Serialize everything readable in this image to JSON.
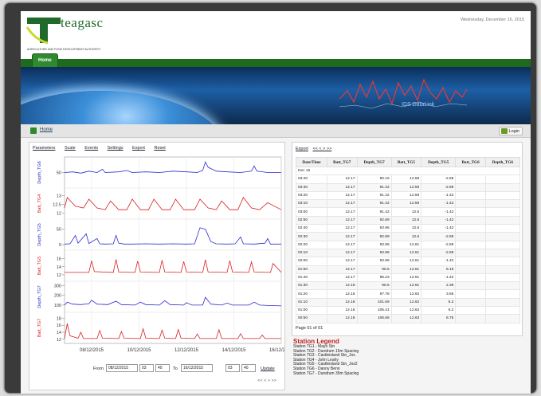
{
  "header": {
    "brand": "teagasc",
    "tagline": "AGRICULTURE AND FOOD DEVELOPMENT AUTHORITY",
    "date": "Wednesday, December 16, 2015",
    "nav_home": "Home",
    "banner_text": "IDS DataLink"
  },
  "crumb": {
    "home": "Home",
    "login": "Login"
  },
  "toolbar": [
    "Parameters",
    "Scale",
    "Events",
    "Settings",
    "Export",
    "Reset"
  ],
  "date_range": {
    "from_label": "From",
    "from_date": "08/12/2015",
    "from_hour": "03",
    "from_min": "40",
    "to_label": "To",
    "to_date": "16/12/2015",
    "to_hour": "03",
    "to_min": "40",
    "update": "Update",
    "pager": "<< < > >>"
  },
  "table_nav": {
    "export": "Export",
    "pager": "<< < > >>"
  },
  "table": {
    "columns": [
      "Date/Time",
      "Batt_TG7",
      "Depth_TG7",
      "Batt_TG5",
      "Depth_TG5",
      "Batt_TG6",
      "Depth_TG6"
    ],
    "group": "Dec 16",
    "rows": [
      [
        "03:40",
        "12.17",
        "90.15",
        "12.58",
        "-2.69",
        "",
        ""
      ],
      [
        "03:30",
        "12.17",
        "91.42",
        "12.59",
        "-2.69",
        "",
        ""
      ],
      [
        "03:20",
        "12.17",
        "91.42",
        "12.59",
        "-1.42",
        "",
        ""
      ],
      [
        "03:10",
        "12.17",
        "91.42",
        "12.59",
        "-1.42",
        "",
        ""
      ],
      [
        "03:00",
        "12.17",
        "91.42",
        "12.6",
        "-1.42",
        "",
        ""
      ],
      [
        "02:50",
        "12.17",
        "92.69",
        "12.6",
        "-1.42",
        "",
        ""
      ],
      [
        "02:40",
        "12.17",
        "93.96",
        "12.6",
        "-1.42",
        "",
        ""
      ],
      [
        "02:30",
        "12.17",
        "92.69",
        "12.6",
        "-2.69",
        "",
        ""
      ],
      [
        "02:20",
        "12.17",
        "93.96",
        "12.61",
        "-2.69",
        "",
        ""
      ],
      [
        "02:10",
        "12.17",
        "93.96",
        "12.61",
        "-2.69",
        "",
        ""
      ],
      [
        "02:00",
        "12.17",
        "93.96",
        "12.61",
        "-1.42",
        "",
        ""
      ],
      [
        "01:50",
        "12.17",
        "96.5",
        "12.61",
        "8.15",
        "",
        ""
      ],
      [
        "01:40",
        "12.17",
        "95.23",
        "12.61",
        "-1.42",
        "",
        ""
      ],
      [
        "01:30",
        "12.18",
        "96.5",
        "12.61",
        "2.39",
        "",
        ""
      ],
      [
        "01:20",
        "12.18",
        "97.78",
        "12.62",
        "3.66",
        "",
        ""
      ],
      [
        "01:10",
        "12.18",
        "101.59",
        "12.62",
        "6.2",
        "",
        ""
      ],
      [
        "01:00",
        "12.18",
        "105.41",
        "12.62",
        "6.2",
        "",
        ""
      ],
      [
        "00:50",
        "12.18",
        "106.68",
        "12.63",
        "8.75",
        "",
        ""
      ]
    ],
    "page_info": "Page 01 of 01"
  },
  "legend": {
    "title": "Station Legend",
    "items": [
      "Station TG1 - Mayo Stn",
      "Station TG2 - Dundrum 15m Spacing",
      "Station TG3 - Castleisland Stn_Jos",
      "Station TG4 - John Leahy",
      "Station TG5 - Castleisland Stn_Jos2",
      "Station TG6 - Danny Benn",
      "Station TG7 - Dundrum 35m Spacing"
    ]
  },
  "colors": {
    "depth": "#2b2bd0",
    "batt": "#d82020",
    "brand": "#1f6a2a",
    "nav": "#1e6b1e"
  },
  "chart_data": {
    "type": "line",
    "x_ticks": [
      "08/12/2015",
      "10/12/2015",
      "12/12/2015",
      "14/12/2015",
      "16/12/2015"
    ],
    "xlim": [
      0,
      8
    ],
    "panels": [
      {
        "series": "Depth_TG6",
        "ylabel": "Depth_TG6",
        "color": "#2b2bd0",
        "ticks": [
          50
        ],
        "ylim": [
          30,
          70
        ],
        "points": [
          [
            0,
            50
          ],
          [
            0.3,
            51
          ],
          [
            0.6,
            49
          ],
          [
            0.9,
            52
          ],
          [
            1.2,
            50
          ],
          [
            1.4,
            55
          ],
          [
            1.5,
            50
          ],
          [
            2,
            51
          ],
          [
            2.3,
            53
          ],
          [
            2.5,
            50
          ],
          [
            3,
            51
          ],
          [
            3.5,
            50
          ],
          [
            4,
            52
          ],
          [
            4.5,
            51
          ],
          [
            4.9,
            50
          ],
          [
            5.1,
            53
          ],
          [
            5.2,
            66
          ],
          [
            5.3,
            58
          ],
          [
            5.6,
            52
          ],
          [
            6,
            51
          ],
          [
            6.5,
            50
          ],
          [
            6.9,
            52
          ],
          [
            7,
            60
          ],
          [
            7.1,
            52
          ],
          [
            7.5,
            50
          ],
          [
            8,
            50
          ]
        ]
      },
      {
        "series": "Batt_TG4",
        "ylabel": "Batt_TG4",
        "color": "#d82020",
        "ticks": [
          12,
          12.5,
          13
        ],
        "ylim": [
          11.8,
          13.3
        ],
        "points": [
          [
            0,
            12.3
          ],
          [
            0.1,
            12.9
          ],
          [
            0.4,
            12.4
          ],
          [
            0.7,
            12.3
          ],
          [
            0.9,
            12.8
          ],
          [
            1.2,
            12.3
          ],
          [
            1.5,
            12.2
          ],
          [
            1.7,
            12.7
          ],
          [
            2.0,
            12.2
          ],
          [
            2.3,
            12.2
          ],
          [
            2.5,
            12.8
          ],
          [
            2.8,
            12.2
          ],
          [
            3.1,
            12.2
          ],
          [
            3.3,
            12.8
          ],
          [
            3.6,
            12.2
          ],
          [
            3.9,
            12.2
          ],
          [
            4.1,
            12.8
          ],
          [
            4.4,
            12.2
          ],
          [
            4.8,
            12.2
          ],
          [
            5.0,
            12.8
          ],
          [
            5.3,
            12.3
          ],
          [
            5.6,
            12.2
          ],
          [
            5.8,
            12.7
          ],
          [
            6.1,
            12.2
          ],
          [
            6.4,
            12.2
          ],
          [
            6.6,
            12.9
          ],
          [
            6.9,
            12.3
          ],
          [
            7.2,
            12.2
          ],
          [
            7.5,
            12.6
          ],
          [
            8,
            12.2
          ]
        ]
      },
      {
        "series": "Depth_TG5",
        "ylabel": "Depth_TG5",
        "color": "#2b2bd0",
        "ticks": [
          0,
          50
        ],
        "ylim": [
          -10,
          75
        ],
        "points": [
          [
            0,
            2
          ],
          [
            0.2,
            3
          ],
          [
            0.4,
            30
          ],
          [
            0.5,
            5
          ],
          [
            0.8,
            35
          ],
          [
            0.9,
            4
          ],
          [
            1.2,
            20
          ],
          [
            1.3,
            3
          ],
          [
            1.5,
            2
          ],
          [
            1.8,
            3
          ],
          [
            1.9,
            30
          ],
          [
            2.0,
            5
          ],
          [
            2.2,
            2
          ],
          [
            2.5,
            2
          ],
          [
            3,
            3
          ],
          [
            3.5,
            2
          ],
          [
            4,
            3
          ],
          [
            4.5,
            2
          ],
          [
            4.8,
            3
          ],
          [
            5.0,
            55
          ],
          [
            5.2,
            50
          ],
          [
            5.4,
            10
          ],
          [
            5.6,
            3
          ],
          [
            6,
            2
          ],
          [
            6.3,
            3
          ],
          [
            6.5,
            25
          ],
          [
            6.6,
            3
          ],
          [
            7,
            2
          ],
          [
            7.4,
            5
          ],
          [
            7.5,
            20
          ],
          [
            7.6,
            2
          ],
          [
            8,
            2
          ]
        ]
      },
      {
        "series": "Batt_TG5",
        "ylabel": "Batt_TG5",
        "color": "#d82020",
        "ticks": [
          12,
          14,
          16
        ],
        "ylim": [
          11,
          17.5
        ],
        "points": [
          [
            0,
            12.6
          ],
          [
            0.9,
            12.6
          ],
          [
            1.0,
            15.5
          ],
          [
            1.1,
            12.8
          ],
          [
            1.8,
            12.6
          ],
          [
            1.9,
            15.8
          ],
          [
            2.0,
            12.7
          ],
          [
            2.6,
            12.6
          ],
          [
            2.7,
            15.4
          ],
          [
            2.8,
            12.7
          ],
          [
            3.5,
            12.6
          ],
          [
            3.6,
            15.6
          ],
          [
            3.7,
            12.7
          ],
          [
            4.3,
            12.6
          ],
          [
            4.4,
            15.3
          ],
          [
            4.5,
            12.7
          ],
          [
            5.1,
            12.6
          ],
          [
            5.2,
            15.7
          ],
          [
            5.3,
            12.7
          ],
          [
            6.0,
            12.6
          ],
          [
            6.1,
            15.5
          ],
          [
            6.2,
            12.7
          ],
          [
            6.8,
            12.6
          ],
          [
            6.9,
            15.2
          ],
          [
            7.0,
            12.7
          ],
          [
            7.6,
            12.6
          ],
          [
            7.7,
            14.8
          ],
          [
            8,
            12.6
          ]
        ]
      },
      {
        "series": "Depth_TG7",
        "ylabel": "Depth_TG7",
        "color": "#2b2bd0",
        "ticks": [
          100,
          200,
          300
        ],
        "ylim": [
          50,
          320
        ],
        "points": [
          [
            0,
            100
          ],
          [
            0.1,
            130
          ],
          [
            0.3,
            110
          ],
          [
            0.6,
            105
          ],
          [
            0.9,
            115
          ],
          [
            1.0,
            150
          ],
          [
            1.2,
            110
          ],
          [
            1.6,
            105
          ],
          [
            1.9,
            140
          ],
          [
            2.1,
            105
          ],
          [
            2.6,
            100
          ],
          [
            2.8,
            130
          ],
          [
            3.0,
            105
          ],
          [
            3.5,
            100
          ],
          [
            3.7,
            145
          ],
          [
            3.9,
            105
          ],
          [
            4.4,
            100
          ],
          [
            4.5,
            125
          ],
          [
            4.7,
            100
          ],
          [
            5.1,
            100
          ],
          [
            5.2,
            180
          ],
          [
            5.4,
            110
          ],
          [
            5.8,
            100
          ],
          [
            6.0,
            120
          ],
          [
            6.2,
            100
          ],
          [
            6.8,
            100
          ],
          [
            7.0,
            130
          ],
          [
            7.2,
            100
          ],
          [
            7.6,
            95
          ],
          [
            8,
            92
          ]
        ]
      },
      {
        "series": "Batt_TG7",
        "ylabel": "Batt_TG7",
        "color": "#d82020",
        "ticks": [
          12,
          14,
          16,
          18
        ],
        "ylim": [
          11.5,
          19
        ],
        "points": [
          [
            0,
            12.2
          ],
          [
            0.1,
            16.5
          ],
          [
            0.2,
            13
          ],
          [
            0.5,
            12.3
          ],
          [
            0.6,
            14
          ],
          [
            0.7,
            12.2
          ],
          [
            1.2,
            12.2
          ],
          [
            1.3,
            14.5
          ],
          [
            1.4,
            12.3
          ],
          [
            2.0,
            12.2
          ],
          [
            2.1,
            14.2
          ],
          [
            2.2,
            12.3
          ],
          [
            2.8,
            12.2
          ],
          [
            2.9,
            15
          ],
          [
            3.0,
            12.3
          ],
          [
            3.5,
            12.2
          ],
          [
            3.6,
            14.6
          ],
          [
            3.7,
            12.3
          ],
          [
            4.1,
            12.2
          ],
          [
            4.2,
            14.8
          ],
          [
            4.3,
            12.3
          ],
          [
            4.8,
            12.2
          ],
          [
            4.9,
            13.5
          ],
          [
            5.0,
            12.2
          ],
          [
            5.6,
            12.2
          ],
          [
            5.7,
            14.7
          ],
          [
            5.8,
            12.2
          ],
          [
            6.4,
            12.2
          ],
          [
            6.5,
            13.6
          ],
          [
            6.6,
            12.2
          ],
          [
            7.2,
            12.2
          ],
          [
            7.3,
            13.2
          ],
          [
            7.4,
            12.2
          ],
          [
            8,
            12.2
          ]
        ]
      }
    ]
  }
}
